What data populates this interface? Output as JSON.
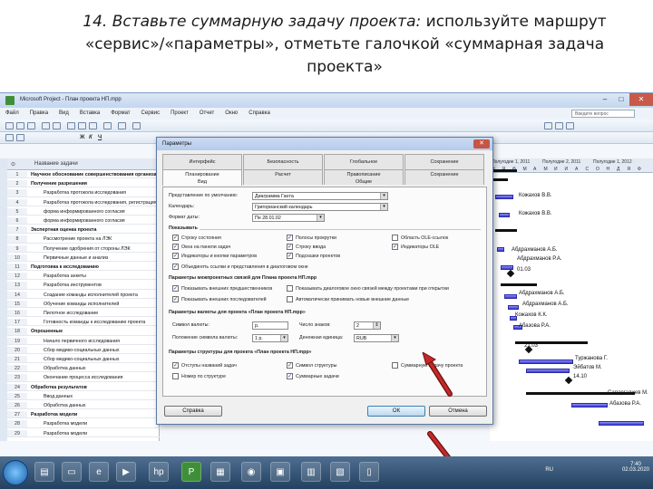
{
  "slide": {
    "title_italic": "14. Вставьте суммарную задачу проекта:",
    "title_rest": "используйте маршрут «сервис»/«параметры», отметьте галочкой «суммарная задача проекта»"
  },
  "window": {
    "title": "Microsoft Project - План проекта НП.mpp",
    "menu": [
      "Файл",
      "Правка",
      "Вид",
      "Вставка",
      "Формат",
      "Сервис",
      "Проект",
      "Отчет",
      "Окно",
      "Справка"
    ],
    "help_placeholder": "Введите вопрос"
  },
  "sheet": {
    "column_task_name": "Название задачи",
    "rows": [
      {
        "num": "1",
        "name": "Научное обоснование совершенствования организационной структуры ЛМС Республики Казахстан",
        "summary": true
      },
      {
        "num": "2",
        "name": "Получение разрешения",
        "summary": true
      },
      {
        "num": "3",
        "name": "Разработка протокола исследования",
        "summary": false
      },
      {
        "num": "4",
        "name": "Разработка протокола исследования, регистрация",
        "summary": false
      },
      {
        "num": "5",
        "name": "форма информированного согласия",
        "summary": false
      },
      {
        "num": "6",
        "name": "форма информированного согласия",
        "summary": false
      },
      {
        "num": "7",
        "name": "Экспертная оценка проекта",
        "summary": true
      },
      {
        "num": "8",
        "name": "Рассмотрение проекта на ЛЭК",
        "summary": false
      },
      {
        "num": "9",
        "name": "Получение одобрения от стороны ЛЭК",
        "summary": false
      },
      {
        "num": "10",
        "name": "Первичные данные и анализ",
        "summary": false
      },
      {
        "num": "11",
        "name": "Подготовка к исследованию",
        "summary": true
      },
      {
        "num": "12",
        "name": "Разработка анкеты",
        "summary": false
      },
      {
        "num": "13",
        "name": "Разработка инструментов",
        "summary": false
      },
      {
        "num": "14",
        "name": "Создание команды исполнителей проекта",
        "summary": false
      },
      {
        "num": "15",
        "name": "Обучение команды исполнителей",
        "summary": false
      },
      {
        "num": "16",
        "name": "Пилотное исследование",
        "summary": false
      },
      {
        "num": "17",
        "name": "Готовность команды к исследованию проекта",
        "summary": false
      },
      {
        "num": "18",
        "name": "Опрошенные",
        "summary": true
      },
      {
        "num": "19",
        "name": "Начало первичного исследования",
        "summary": false
      },
      {
        "num": "20",
        "name": "Сбор медико-социальных данных",
        "summary": false
      },
      {
        "num": "21",
        "name": "Сбор медико-социальных данных",
        "summary": false
      },
      {
        "num": "22",
        "name": "Обработка данных",
        "summary": false
      },
      {
        "num": "23",
        "name": "Окончание процесса исследования",
        "summary": false
      },
      {
        "num": "24",
        "name": "Обработка результатов",
        "summary": true
      },
      {
        "num": "25",
        "name": "Ввод данных",
        "summary": false
      },
      {
        "num": "26",
        "name": "Обработка данных",
        "summary": false
      },
      {
        "num": "27",
        "name": "Разработка модели",
        "summary": true
      },
      {
        "num": "28",
        "name": "Разработка модели",
        "summary": false
      },
      {
        "num": "29",
        "name": "Разработка модели",
        "summary": false
      }
    ]
  },
  "gantt": {
    "header_top": [
      "Полугодие 1, 2011",
      "Полугодие 2, 2011",
      "Полугодие 1, 2012"
    ],
    "header_months": [
      "Н",
      "Я",
      "Ф",
      "М",
      "А",
      "М",
      "И",
      "И",
      "А",
      "С",
      "О",
      "Н",
      "Д",
      "Я",
      "Ф"
    ],
    "labels": [
      "Кожахов В.В.",
      "Кожахов В.В.",
      "Абдрахманов А.Б.",
      "Абдрахманов Р.А.",
      "01.03",
      "Абдрахманов А.Б.",
      "Абдрахманов А.Б.",
      "Кожахов К.К.",
      "Абазова Р.А.",
      "21.03",
      "Туржанова Г.",
      "Эйбатов М.",
      "14.10",
      "Сапаргалиев М.",
      "Абазова Р.А."
    ]
  },
  "dialog": {
    "title": "Параметры",
    "close": "✕",
    "tabs_row1": [
      "Интерфейс",
      "Безопасность",
      "Глобальное",
      "Сохранение"
    ],
    "tabs_row2": [
      "Планирование",
      "Расчет",
      "Правописание",
      "Сохранение"
    ],
    "tab_row2_sub": [
      "Вид",
      "",
      "Общие",
      ""
    ],
    "active_tab": "Вид",
    "fields": {
      "default_view_label": "Представление по умолчанию:",
      "default_view_value": "Диаграмма Ганта",
      "date_format_label": "Формат даты:",
      "date_format_value": "Пн 28.01.02",
      "calendar_label": "Календарь:",
      "calendar_value": "Григорианский календарь"
    },
    "show_section": "Показывать",
    "show_options": [
      {
        "label": "Строку состояния",
        "checked": true
      },
      {
        "label": "Окна на панели задач",
        "checked": true
      },
      {
        "label": "Индикаторы и кнопки параметров",
        "checked": true
      },
      {
        "label": "Полосы прокрутки",
        "checked": true
      },
      {
        "label": "Строку ввода",
        "checked": true
      },
      {
        "label": "Область OLE-ссылок",
        "checked": false
      },
      {
        "label": "Индикаторы OLE",
        "checked": true
      },
      {
        "label": "Подсказки проектов",
        "checked": true
      }
    ],
    "show_option_wide": "Объединять ссылки и представления в диалоговом окне",
    "crossproject_section": "Параметры межпроектных связей для Плана проекта НП.mpp",
    "crossproject_options": [
      {
        "label": "Показывать внешних предшественников",
        "checked": true
      },
      {
        "label": "Показывать диалоговое окно связей между проектами при открытии",
        "checked": false
      },
      {
        "label": "Показывать внешних последователей",
        "checked": true
      },
      {
        "label": "Автоматически принимать новые внешние данные",
        "checked": false
      }
    ],
    "currency_section": "Параметры валюты для проекта «План проекта НП.mpp»",
    "currency_symbol_label": "Символ валюты:",
    "currency_symbol_value": "р.",
    "currency_decimals_label": "Число знаков:",
    "currency_decimals_value": "2",
    "currency_position_label": "Положение символа валюты:",
    "currency_position_value": "1 р.",
    "currency_code_label": "Денежная единица:",
    "currency_code_value": "RUB",
    "outline_section": "Параметры структуры для проекта «План проекта НП.mpp»",
    "outline_options": [
      {
        "label": "Отступы названий задач",
        "checked": true
      },
      {
        "label": "Номер по структуре",
        "checked": false
      },
      {
        "label": "Символ структуры",
        "checked": true
      },
      {
        "label": "Суммарные задачи",
        "checked": true
      },
      {
        "label": "Суммарную задачу проекта",
        "checked": false
      }
    ],
    "help_button": "Справка",
    "ok_button": "ОК",
    "cancel_button": "Отмена"
  },
  "taskbar": {
    "language": "RU",
    "time": "7:40",
    "date": "02.03.2020"
  },
  "colors": {
    "arrow": "#c62828",
    "gantt_bar": "#3b3bd4",
    "dialog_bg": "#f0f0f0"
  }
}
